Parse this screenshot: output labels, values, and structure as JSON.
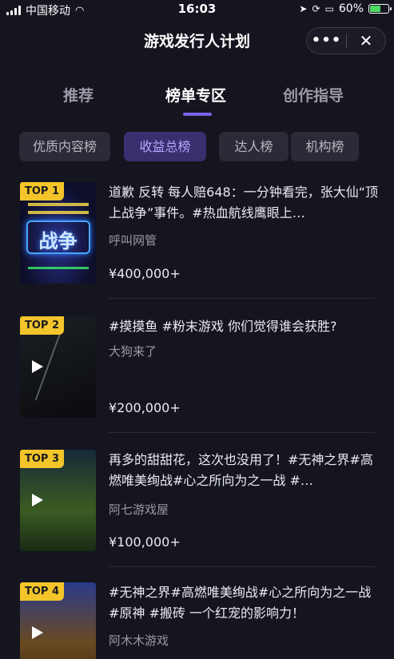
{
  "status_bar": {
    "carrier": "中国移动",
    "time": "16:03",
    "battery": "60%",
    "battery_level": 0.6
  },
  "header": {
    "title": "游戏发行人计划",
    "more_label": "•••",
    "close_label": "✕"
  },
  "tabs": [
    {
      "label": "推荐",
      "active": false
    },
    {
      "label": "榜单专区",
      "active": true
    },
    {
      "label": "创作指导",
      "active": false
    }
  ],
  "chips": [
    {
      "label": "优质内容榜",
      "active": false
    },
    {
      "label": "收益总榜",
      "active": true
    },
    {
      "label": "达人榜",
      "active": false
    },
    {
      "label": "机构榜",
      "active": false
    }
  ],
  "ranking": [
    {
      "badge": "TOP 1",
      "desc": "道歉 反转 每人赔648：一分钟看完，张大仙“顶上战争”事件。#热血航线鹰眼上…",
      "author": "呼叫网管",
      "amount": "¥400,000+",
      "thumb_text": "战争"
    },
    {
      "badge": "TOP 2",
      "desc": "#摸摸鱼 #粉末游戏 你们觉得谁会获胜?",
      "author": "大狗来了",
      "amount": "¥200,000+"
    },
    {
      "badge": "TOP 3",
      "desc": "再多的甜甜花，这次也没用了！#无神之界#高燃唯美绚战#心之所向为之一战 #…",
      "author": "阿七游戏屋",
      "amount": "¥100,000+"
    },
    {
      "badge": "TOP 4",
      "desc": "#无神之界#高燃唯美绚战#心之所向为之一战 #原神 #搬砖 一个红宠的影响力！",
      "author": "阿木木游戏",
      "amount": ""
    }
  ]
}
